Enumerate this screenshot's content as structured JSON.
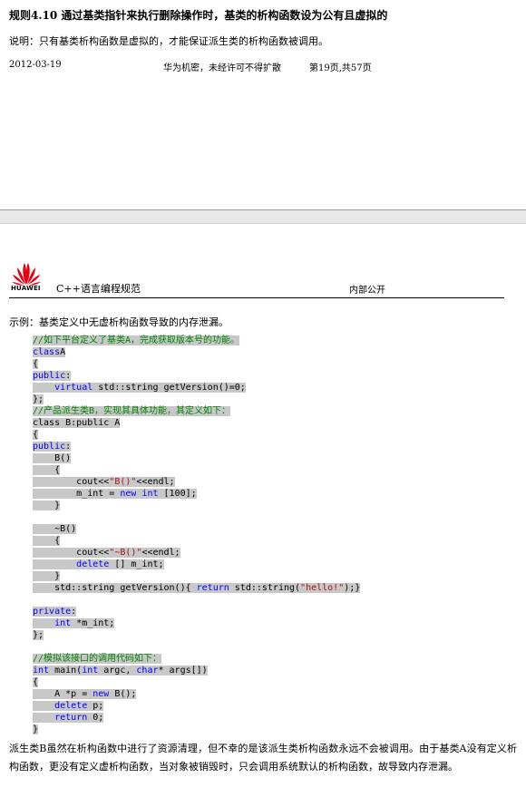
{
  "top_section": {
    "rule_title": "规则4.10 通过基类指针来执行删除操作时，基类的析构函数设为公有且虚拟的",
    "note": "说明：只有基类析构函数是虚拟的，才能保证派生类的析构函数被调用。",
    "footer": {
      "date": "2012-03-19",
      "confidential": "华为机密，未经许可不得扩散",
      "page": "第19页,共57页"
    }
  },
  "page_header": {
    "logo_text": "HUAWEI",
    "doc_title": "C++语言编程规范",
    "classification": "内部公开"
  },
  "example_heading": "示例：基类定义中无虚析构函数导致的内存泄漏。",
  "code_lines": [
    {
      "indent": 0,
      "tokens": [
        [
          "cm",
          "//如下平台定义了基类A，完成获取版本号的功能。"
        ]
      ]
    },
    {
      "indent": 0,
      "tokens": [
        [
          "kw",
          "class"
        ],
        [
          "",
          "A"
        ]
      ]
    },
    {
      "indent": 0,
      "tokens": [
        [
          "",
          "{"
        ]
      ]
    },
    {
      "indent": 0,
      "tokens": [
        [
          "kw",
          "public"
        ],
        [
          "",
          ":"
        ]
      ]
    },
    {
      "indent": 4,
      "tokens": [
        [
          "kw",
          "virtual"
        ],
        [
          "",
          " std::string getVersion()=0;"
        ]
      ]
    },
    {
      "indent": 0,
      "tokens": [
        [
          "",
          "};"
        ]
      ]
    },
    {
      "indent": 0,
      "tokens": [
        [
          "cm",
          "//产品派生类B，实现其具体功能，其定义如下："
        ]
      ]
    },
    {
      "indent": 0,
      "tokens": [
        [
          "",
          "class B:public A"
        ]
      ]
    },
    {
      "indent": 0,
      "tokens": [
        [
          "",
          "{"
        ]
      ]
    },
    {
      "indent": 0,
      "tokens": [
        [
          "kw",
          "public"
        ],
        [
          "",
          ":"
        ]
      ]
    },
    {
      "indent": 4,
      "tokens": [
        [
          "",
          "B()"
        ]
      ]
    },
    {
      "indent": 4,
      "tokens": [
        [
          "",
          "{"
        ]
      ]
    },
    {
      "indent": 8,
      "tokens": [
        [
          "",
          "cout<<"
        ],
        [
          "st",
          "\"B()\""
        ],
        [
          "",
          "<<endl;"
        ]
      ]
    },
    {
      "indent": 8,
      "tokens": [
        [
          "",
          "m_int = "
        ],
        [
          "kw",
          "new"
        ],
        [
          "",
          " "
        ],
        [
          "kw",
          "int"
        ],
        [
          "",
          " [100];"
        ]
      ]
    },
    {
      "indent": 4,
      "tokens": [
        [
          "",
          "}"
        ]
      ]
    },
    {
      "blank": true
    },
    {
      "indent": 4,
      "tokens": [
        [
          "",
          "~B()"
        ]
      ]
    },
    {
      "indent": 4,
      "tokens": [
        [
          "",
          "{"
        ]
      ]
    },
    {
      "indent": 8,
      "tokens": [
        [
          "",
          "cout<<"
        ],
        [
          "st",
          "\"~B()\""
        ],
        [
          "",
          "<<endl;"
        ]
      ]
    },
    {
      "indent": 8,
      "tokens": [
        [
          "kw",
          "delete"
        ],
        [
          "",
          " [] m_int;"
        ]
      ]
    },
    {
      "indent": 4,
      "tokens": [
        [
          "",
          "}"
        ]
      ]
    },
    {
      "indent": 4,
      "tokens": [
        [
          "",
          "std::string getVersion(){ "
        ],
        [
          "kw",
          "return"
        ],
        [
          "",
          " std::string("
        ],
        [
          "st",
          "\"hello!\""
        ],
        [
          "",
          ");}"
        ]
      ]
    },
    {
      "blank": true
    },
    {
      "indent": 0,
      "tokens": [
        [
          "kw",
          "private"
        ],
        [
          "",
          ":"
        ]
      ]
    },
    {
      "indent": 4,
      "tokens": [
        [
          "kw",
          "int"
        ],
        [
          "",
          " *m_int;"
        ]
      ]
    },
    {
      "indent": 0,
      "tokens": [
        [
          "",
          "};"
        ]
      ]
    },
    {
      "blank": true
    },
    {
      "indent": 0,
      "tokens": [
        [
          "cm",
          "//模拟该接口的调用代码如下："
        ]
      ]
    },
    {
      "indent": 0,
      "tokens": [
        [
          "kw",
          "int"
        ],
        [
          "",
          " main("
        ],
        [
          "kw",
          "int"
        ],
        [
          "",
          " argc, "
        ],
        [
          "kw",
          "char"
        ],
        [
          "",
          "* args[])"
        ]
      ]
    },
    {
      "indent": 0,
      "tokens": [
        [
          "",
          "{"
        ]
      ]
    },
    {
      "indent": 4,
      "tokens": [
        [
          "",
          "A *p = "
        ],
        [
          "kw",
          "new"
        ],
        [
          "",
          " B();"
        ]
      ]
    },
    {
      "indent": 4,
      "tokens": [
        [
          "kw",
          "delete"
        ],
        [
          "",
          " p;"
        ]
      ]
    },
    {
      "indent": 4,
      "tokens": [
        [
          "kw",
          "return"
        ],
        [
          "",
          " 0;"
        ]
      ]
    },
    {
      "indent": 0,
      "tokens": [
        [
          "",
          "}"
        ]
      ]
    }
  ],
  "explanation": "派生类B虽然在析构函数中进行了资源清理，但不幸的是该派生类析构函数永远不会被调用。由于基类A没有定义析构函数，更没有定义虚析构函数，当对象被销毁时，只会调用系统默认的析构函数，故导致内存泄漏。"
}
